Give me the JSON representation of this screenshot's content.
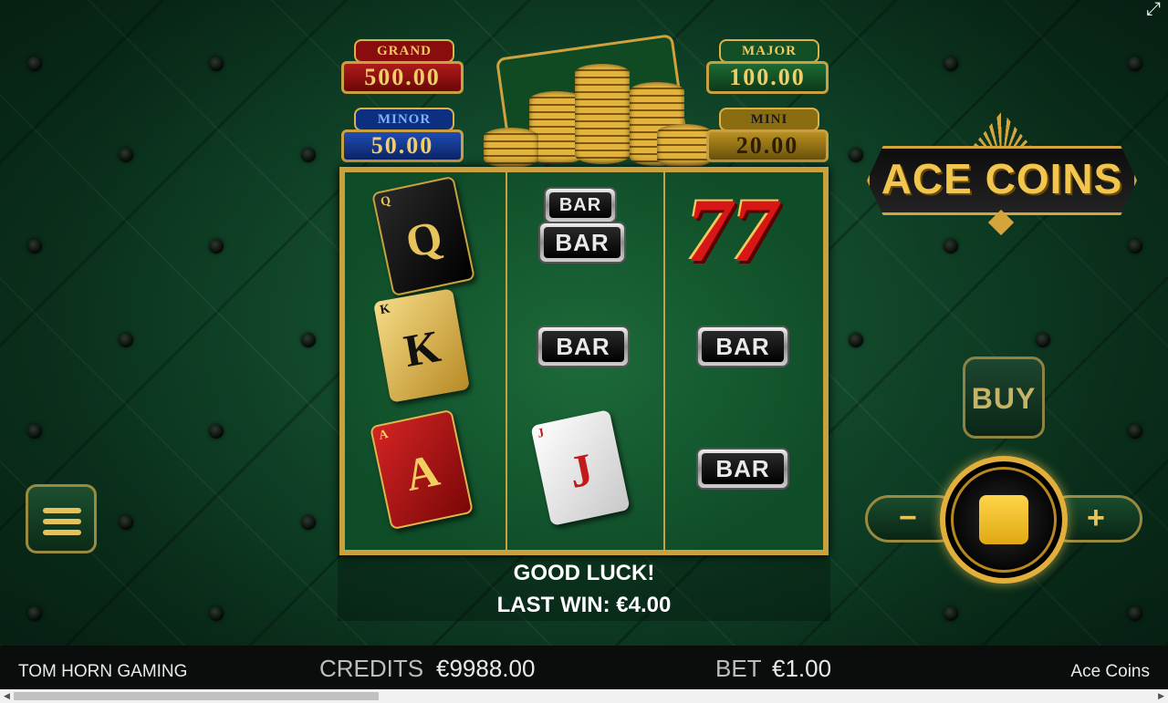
{
  "jackpots": {
    "grand": {
      "label": "GRAND",
      "value": "500.00"
    },
    "major": {
      "label": "MAJOR",
      "value": "100.00"
    },
    "minor": {
      "label": "MINOR",
      "value": "50.00"
    },
    "mini": {
      "label": "MINI",
      "value": "20.00"
    }
  },
  "logo": {
    "text": "ACE COINS"
  },
  "reels": {
    "col1": [
      {
        "type": "card",
        "rank": "Q",
        "suit": "♠",
        "style": "black"
      },
      {
        "type": "card",
        "rank": "K",
        "suit": "♣",
        "style": "gold"
      },
      {
        "type": "card",
        "rank": "A",
        "suit": "♥",
        "style": "red"
      }
    ],
    "col2": [
      {
        "type": "bar",
        "label": "BAR"
      },
      {
        "type": "bar",
        "label": "BAR"
      },
      {
        "type": "card",
        "rank": "J",
        "suit": "♦",
        "style": "white"
      }
    ],
    "col3": [
      {
        "type": "seven",
        "label": "77"
      },
      {
        "type": "bar",
        "label": "BAR"
      },
      {
        "type": "bar",
        "label": "BAR"
      }
    ],
    "bar_label": "BAR"
  },
  "messages": {
    "good_luck": "GOOD LUCK!",
    "last_win": "LAST WIN: €4.00"
  },
  "controls": {
    "buy": "BUY",
    "minus": "−",
    "plus": "+"
  },
  "bottom": {
    "provider": "TOM HORN GAMING",
    "credits_label": "CREDITS",
    "credits_value": "€9988.00",
    "bet_label": "BET",
    "bet_value": "€1.00",
    "game_name": "Ace Coins"
  },
  "colors": {
    "gold": "#c9a03e",
    "felt": "#0f4428",
    "seven_red": "#d81616"
  }
}
